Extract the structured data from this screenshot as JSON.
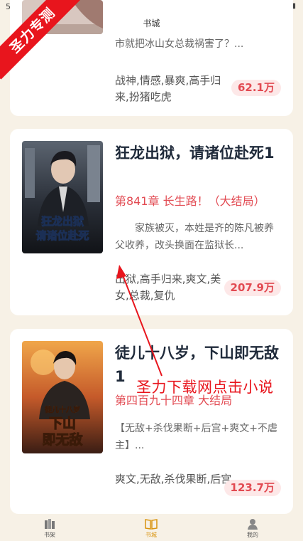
{
  "status_bar": {
    "time": "5:03",
    "icons": "⊙ ▾ ▮"
  },
  "watermark": {
    "ribbon": "圣力专测",
    "caption": "圣力下载网点击小说"
  },
  "header": {
    "title": "书城"
  },
  "books": [
    {
      "intro": "市就把冰山女总裁祸害了？...",
      "tags": "战神,情感,暴爽,高手归来,扮猪吃虎",
      "count": "62.1万"
    },
    {
      "title": "狂龙出狱，请诸位赴死1",
      "chapter": "第841章 长生路！（大结局）",
      "intro": "家族被灭，本姓是齐的陈凡被养父收养，改头换面在监狱长...",
      "tags": "出狱,高手归来,爽文,美女,总裁,复仇",
      "count": "207.9万",
      "cover_text_line1": "狂龙出狱",
      "cover_text_line2": "请诸位赴死"
    },
    {
      "title": "徒儿十八岁，下山即无敌1",
      "chapter": "第四百九十四章 大结局",
      "intro": "【无敌+杀伐果断+后宫+爽文+不虐主】...",
      "tags": "爽文,无敌,杀伐果断,后宫",
      "count": "123.7万",
      "cover_text_line1": "徒儿十八岁",
      "cover_text_line2": "下山",
      "cover_text_line3": "即无敌"
    }
  ],
  "tabs": [
    {
      "label": "书架",
      "icon": "bookshelf-icon"
    },
    {
      "label": "书城",
      "icon": "bookstore-icon",
      "active": true
    },
    {
      "label": "我的",
      "icon": "profile-icon"
    }
  ],
  "colors": {
    "accent_red": "#e24a52",
    "tab_active": "#d9930d",
    "background": "#f7f1e6"
  }
}
